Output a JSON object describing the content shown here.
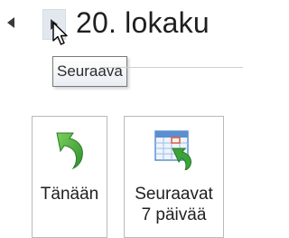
{
  "navigation": {
    "previous_icon": "triangle-left-icon",
    "next_icon": "triangle-right-icon",
    "date_title": "20. lokaku"
  },
  "tooltip": {
    "label": "Seuraava"
  },
  "ribbon": {
    "today_label": "Tänään",
    "today_icon": "green-curved-arrow-icon",
    "next7_line1": "Seuraavat",
    "next7_line2": "7 päivää",
    "next7_icon": "calendar-arrow-icon"
  },
  "colors": {
    "accent_green": "#3aa33a",
    "calendar_blue": "#5b8fd1",
    "highlight_red": "#e05b3b"
  }
}
